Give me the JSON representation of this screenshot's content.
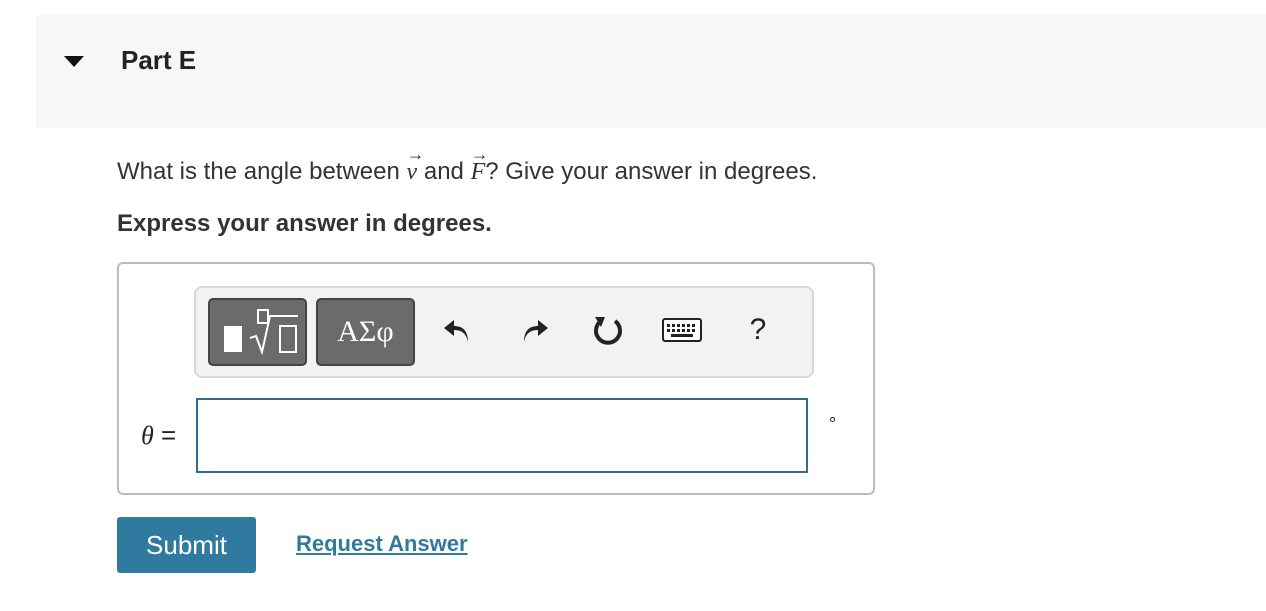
{
  "part": {
    "title": "Part E"
  },
  "question": {
    "prefix": "What is the angle between ",
    "var_v": "v",
    "middle": " and ",
    "var_f": "F",
    "suffix": "? Give your answer in degrees."
  },
  "instruction": "Express your answer in degrees.",
  "toolbar": {
    "greek_label": "ΑΣφ",
    "help_label": "?",
    "icons": [
      "templates-icon",
      "greek-symbols-icon",
      "undo-icon",
      "redo-icon",
      "reset-icon",
      "keyboard-icon",
      "help-icon"
    ]
  },
  "answer": {
    "variable": "θ",
    "equals": "=",
    "value": "",
    "placeholder": "",
    "unit": "°"
  },
  "actions": {
    "submit_label": "Submit",
    "request_label": "Request Answer"
  },
  "colors": {
    "accent": "#2f7a9e",
    "input_border": "#2f6d8b"
  }
}
